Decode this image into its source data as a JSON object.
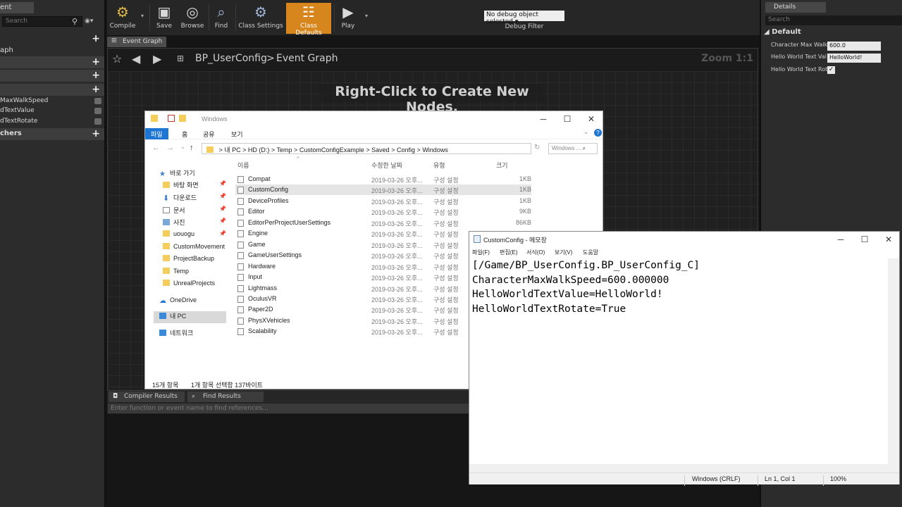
{
  "left_panel": {
    "tab_label": "ent",
    "search_placeholder": "Search",
    "graph_label": "aph",
    "variables": [
      {
        "label": "MaxWalkSpeed"
      },
      {
        "label": "dTextValue"
      },
      {
        "label": "dTextRotate"
      }
    ],
    "dispatchers_label": "chers"
  },
  "toolbar": {
    "compile": "Compile",
    "save": "Save",
    "browse": "Browse",
    "find": "Find",
    "class_settings": "Class Settings",
    "class_defaults": "Class Defaults",
    "play": "Play",
    "debug_select": "No debug object selected",
    "debug_filter": "Debug Filter",
    "icons": [
      "compile-icon",
      "save-icon",
      "browse-icon",
      "find-icon",
      "class-settings-icon",
      "class-defaults-icon",
      "play-icon"
    ]
  },
  "graph": {
    "tab_label": "Event Graph",
    "breadcrumb_blueprint": "BP_UserConfig",
    "breadcrumb_sep": ">",
    "breadcrumb_graph": "Event Graph",
    "zoom": "Zoom 1:1",
    "hint": "Right-Click to Create New Nodes."
  },
  "bottom_panel": {
    "tab_compiler": "Compiler Results",
    "tab_find": "Find Results",
    "search_placeholder": "Enter function or event name to find references..."
  },
  "details": {
    "tab_label": "Details",
    "search_placeholder": "Search",
    "category": "Default",
    "rows": [
      {
        "label": "Character Max Walk",
        "value": "600.0"
      },
      {
        "label": "Hello World Text Val",
        "value": "HelloWorld!"
      },
      {
        "label": "Hello World Text Rot",
        "value": "✓"
      }
    ]
  },
  "explorer": {
    "title": "Windows",
    "ribbon": [
      "파일",
      "홈",
      "공유",
      "보기"
    ],
    "address": [
      "내 PC",
      "HD (D:)",
      "Temp",
      "CustomConfigExample",
      "Saved",
      "Config",
      "Windows"
    ],
    "address_sep": ">",
    "search_placeholder": "Windows ...",
    "nav": [
      {
        "label": "바로 가기",
        "icon": "star-icon"
      },
      {
        "label": "바탕 화면",
        "icon": "folder-icon"
      },
      {
        "label": "다운로드",
        "icon": "download-icon"
      },
      {
        "label": "문서",
        "icon": "document-icon"
      },
      {
        "label": "사진",
        "icon": "picture-icon"
      },
      {
        "label": "uouogu",
        "icon": "folder-icon"
      },
      {
        "label": "CustomMovement",
        "icon": "folder-icon"
      },
      {
        "label": "ProjectBackup",
        "icon": "folder-icon"
      },
      {
        "label": "Temp",
        "icon": "folder-icon"
      },
      {
        "label": "UnrealProjects",
        "icon": "folder-icon"
      },
      {
        "label": "OneDrive",
        "icon": "cloud-icon"
      },
      {
        "label": "내 PC",
        "icon": "pc-icon"
      },
      {
        "label": "네트워크",
        "icon": "network-icon"
      }
    ],
    "columns": {
      "name": "이름",
      "date": "수정한 날짜",
      "type": "유형",
      "size": "크기"
    },
    "files": [
      {
        "name": "Compat",
        "date": "2019-03-26 오후...",
        "type": "구성 설정",
        "size": "1KB"
      },
      {
        "name": "CustomConfig",
        "date": "2019-03-26 오후...",
        "type": "구성 설정",
        "size": "1KB"
      },
      {
        "name": "DeviceProfiles",
        "date": "2019-03-26 오후...",
        "type": "구성 설정",
        "size": "1KB"
      },
      {
        "name": "Editor",
        "date": "2019-03-26 오후...",
        "type": "구성 설정",
        "size": "9KB"
      },
      {
        "name": "EditorPerProjectUserSettings",
        "date": "2019-03-26 오후...",
        "type": "구성 설정",
        "size": "86KB"
      },
      {
        "name": "Engine",
        "date": "2019-03-26 오후...",
        "type": "구성 설정",
        "size": ""
      },
      {
        "name": "Game",
        "date": "2019-03-26 오후...",
        "type": "구성 설정",
        "size": ""
      },
      {
        "name": "GameUserSettings",
        "date": "2019-03-26 오후...",
        "type": "구성 설정",
        "size": ""
      },
      {
        "name": "Hardware",
        "date": "2019-03-26 오후...",
        "type": "구성 설정",
        "size": ""
      },
      {
        "name": "Input",
        "date": "2019-03-26 오후...",
        "type": "구성 설정",
        "size": ""
      },
      {
        "name": "Lightmass",
        "date": "2019-03-26 오후...",
        "type": "구성 설정",
        "size": ""
      },
      {
        "name": "OculusVR",
        "date": "2019-03-26 오후...",
        "type": "구성 설정",
        "size": ""
      },
      {
        "name": "Paper2D",
        "date": "2019-03-26 오후...",
        "type": "구성 설정",
        "size": ""
      },
      {
        "name": "PhysXVehicles",
        "date": "2019-03-26 오후...",
        "type": "구성 설정",
        "size": ""
      },
      {
        "name": "Scalability",
        "date": "2019-03-26 오후...",
        "type": "구성 설정",
        "size": ""
      }
    ],
    "status_count": "15개 항목",
    "status_selected": "1개 항목 선택함 137바이트"
  },
  "notepad": {
    "title": "CustomConfig - 메모장",
    "menu": [
      "파일(F)",
      "편집(E)",
      "서식(O)",
      "보기(V)",
      "도움말"
    ],
    "lines": [
      "[/Game/BP_UserConfig.BP_UserConfig_C]",
      "CharacterMaxWalkSpeed=600.000000",
      "HelloWorldTextValue=HelloWorld!",
      "HelloWorldTextRotate=True"
    ],
    "status_eol": "Windows (CRLF)",
    "status_pos": "Ln 1, Col 1",
    "status_zoom": "100%"
  },
  "colors": {
    "accent": "#d7861e",
    "explorer_ribbon": "#1e76d4"
  }
}
